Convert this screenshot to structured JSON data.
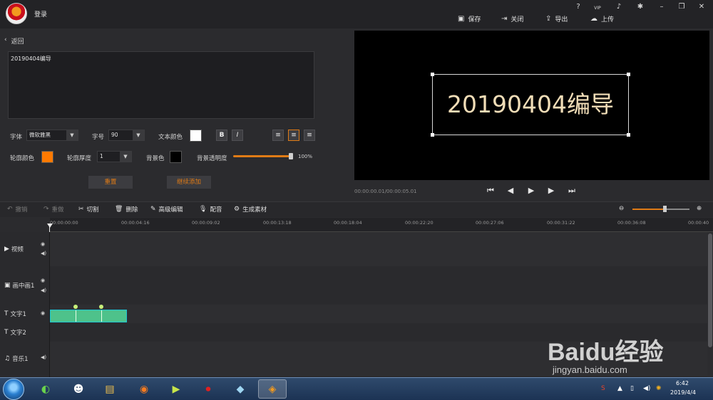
{
  "topbar": {
    "login": "登录",
    "help": "?",
    "vip": "VIP",
    "actions": {
      "save": "保存",
      "close": "关闭",
      "export": "导出",
      "upload": "上传"
    }
  },
  "editor": {
    "back": "返回",
    "text": "20190404编导",
    "font_label": "字体",
    "font_value": "微软雅黑",
    "size_label": "字号",
    "size_value": "90",
    "text_color_label": "文本颜色",
    "text_color": "#ffffff",
    "bold": "B",
    "italic": "I",
    "outline_color_label": "轮廓颜色",
    "outline_color": "#ff7a00",
    "outline_width_label": "轮廓厚度",
    "outline_width_value": "1",
    "bg_color_label": "背景色",
    "bg_color": "#000000",
    "bg_opacity_label": "背景透明度",
    "bg_opacity_value": "100%",
    "bg_opacity_fraction": 1.0,
    "reset": "重置",
    "continue_add": "继续添加"
  },
  "preview": {
    "text": "20190404编导",
    "time": "00:00:00.01/00:00:05.01"
  },
  "toolbar": {
    "undo": "撤销",
    "redo": "重做",
    "cut": "切割",
    "delete": "删除",
    "advanced_edit": "高级编辑",
    "dub": "配音",
    "generate": "生成素材"
  },
  "ruler": {
    "ticks": [
      "00:00:00:00",
      "00:00:04:16",
      "00:00:09:02",
      "00:00:13:18",
      "00:00:18:04",
      "00:00:22:20",
      "00:00:27:06",
      "00:00:31:22",
      "00:00:36:08",
      "00:00:40"
    ]
  },
  "tracks": {
    "video": "视频",
    "pip": "画中画1",
    "text1": "文字1",
    "text2": "文字2",
    "music": "音乐1"
  },
  "taskbar": {
    "time": "6:42",
    "date": "2019/4/4"
  },
  "watermark": {
    "text": "Baidu经验",
    "url": "jingyan.baidu.com"
  },
  "colors": {
    "accent": "#e07b16",
    "clip": "#4ec28b"
  }
}
